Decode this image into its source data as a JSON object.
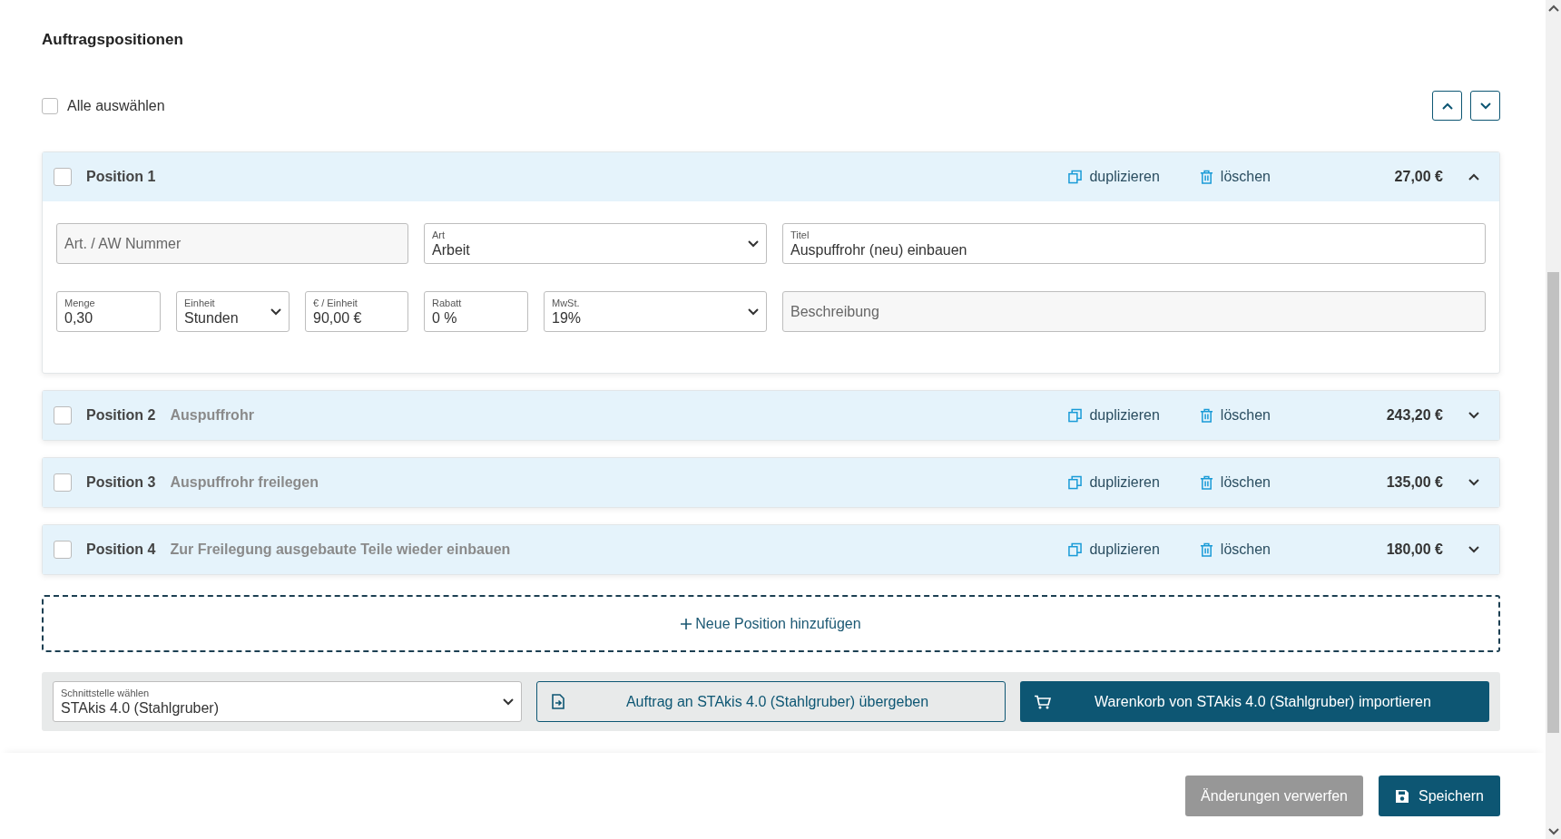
{
  "section_title": "Auftragspositionen",
  "select_all": {
    "label": "Alle auswählen",
    "checked": false
  },
  "positions": [
    {
      "label": "Position 1",
      "selected": false,
      "expanded": true,
      "duplicate": "duplizieren",
      "delete": "löschen",
      "price": "27,00 €",
      "fields": [
        [
          {
            "kind": "input",
            "placeholder": "Art. / AW Nummer"
          },
          {
            "kind": "select",
            "label": "Art",
            "value": "Arbeit"
          },
          {
            "kind": "input",
            "label": "Titel",
            "value": "Auspuffrohr (neu) einbauen"
          }
        ],
        [
          {
            "kind": "input",
            "label": "Menge",
            "value": "0,30"
          },
          {
            "kind": "select",
            "label": "Einheit",
            "value": "Stunden"
          },
          {
            "kind": "input",
            "label": "€ / Einheit",
            "value": "90,00 €"
          },
          {
            "kind": "input",
            "label": "Rabatt",
            "value": "0 %"
          },
          {
            "kind": "select",
            "label": "MwSt.",
            "value": "19%"
          },
          {
            "kind": "input",
            "placeholder": "Beschreibung"
          }
        ]
      ]
    },
    {
      "label": "Position 2",
      "subtitle": "Auspuffrohr",
      "selected": false,
      "expanded": false,
      "duplicate": "duplizieren",
      "delete": "löschen",
      "price": "243,20 €"
    },
    {
      "label": "Position 3",
      "subtitle": "Auspuffrohr freilegen",
      "selected": false,
      "expanded": false,
      "duplicate": "duplizieren",
      "delete": "löschen",
      "price": "135,00 €"
    },
    {
      "label": "Position 4",
      "subtitle": "Zur Freilegung ausgebaute Teile wieder einbauen",
      "selected": false,
      "expanded": false,
      "duplicate": "duplizieren",
      "delete": "löschen",
      "price": "180,00 €"
    }
  ],
  "add_position": "Neue Position hinzufügen",
  "interface_bar": {
    "select": {
      "label": "Schnittstelle wählen",
      "value": "STAkis 4.0 (Stahlgruber)"
    },
    "transfer_button": "Auftrag an STAkis 4.0 (Stahlgruber) übergeben",
    "import_button": "Warenkorb von STAkis 4.0 (Stahlgruber) importieren"
  },
  "footer": {
    "discard_button": "Änderungen verwerfen",
    "save_button": "Speichern"
  }
}
